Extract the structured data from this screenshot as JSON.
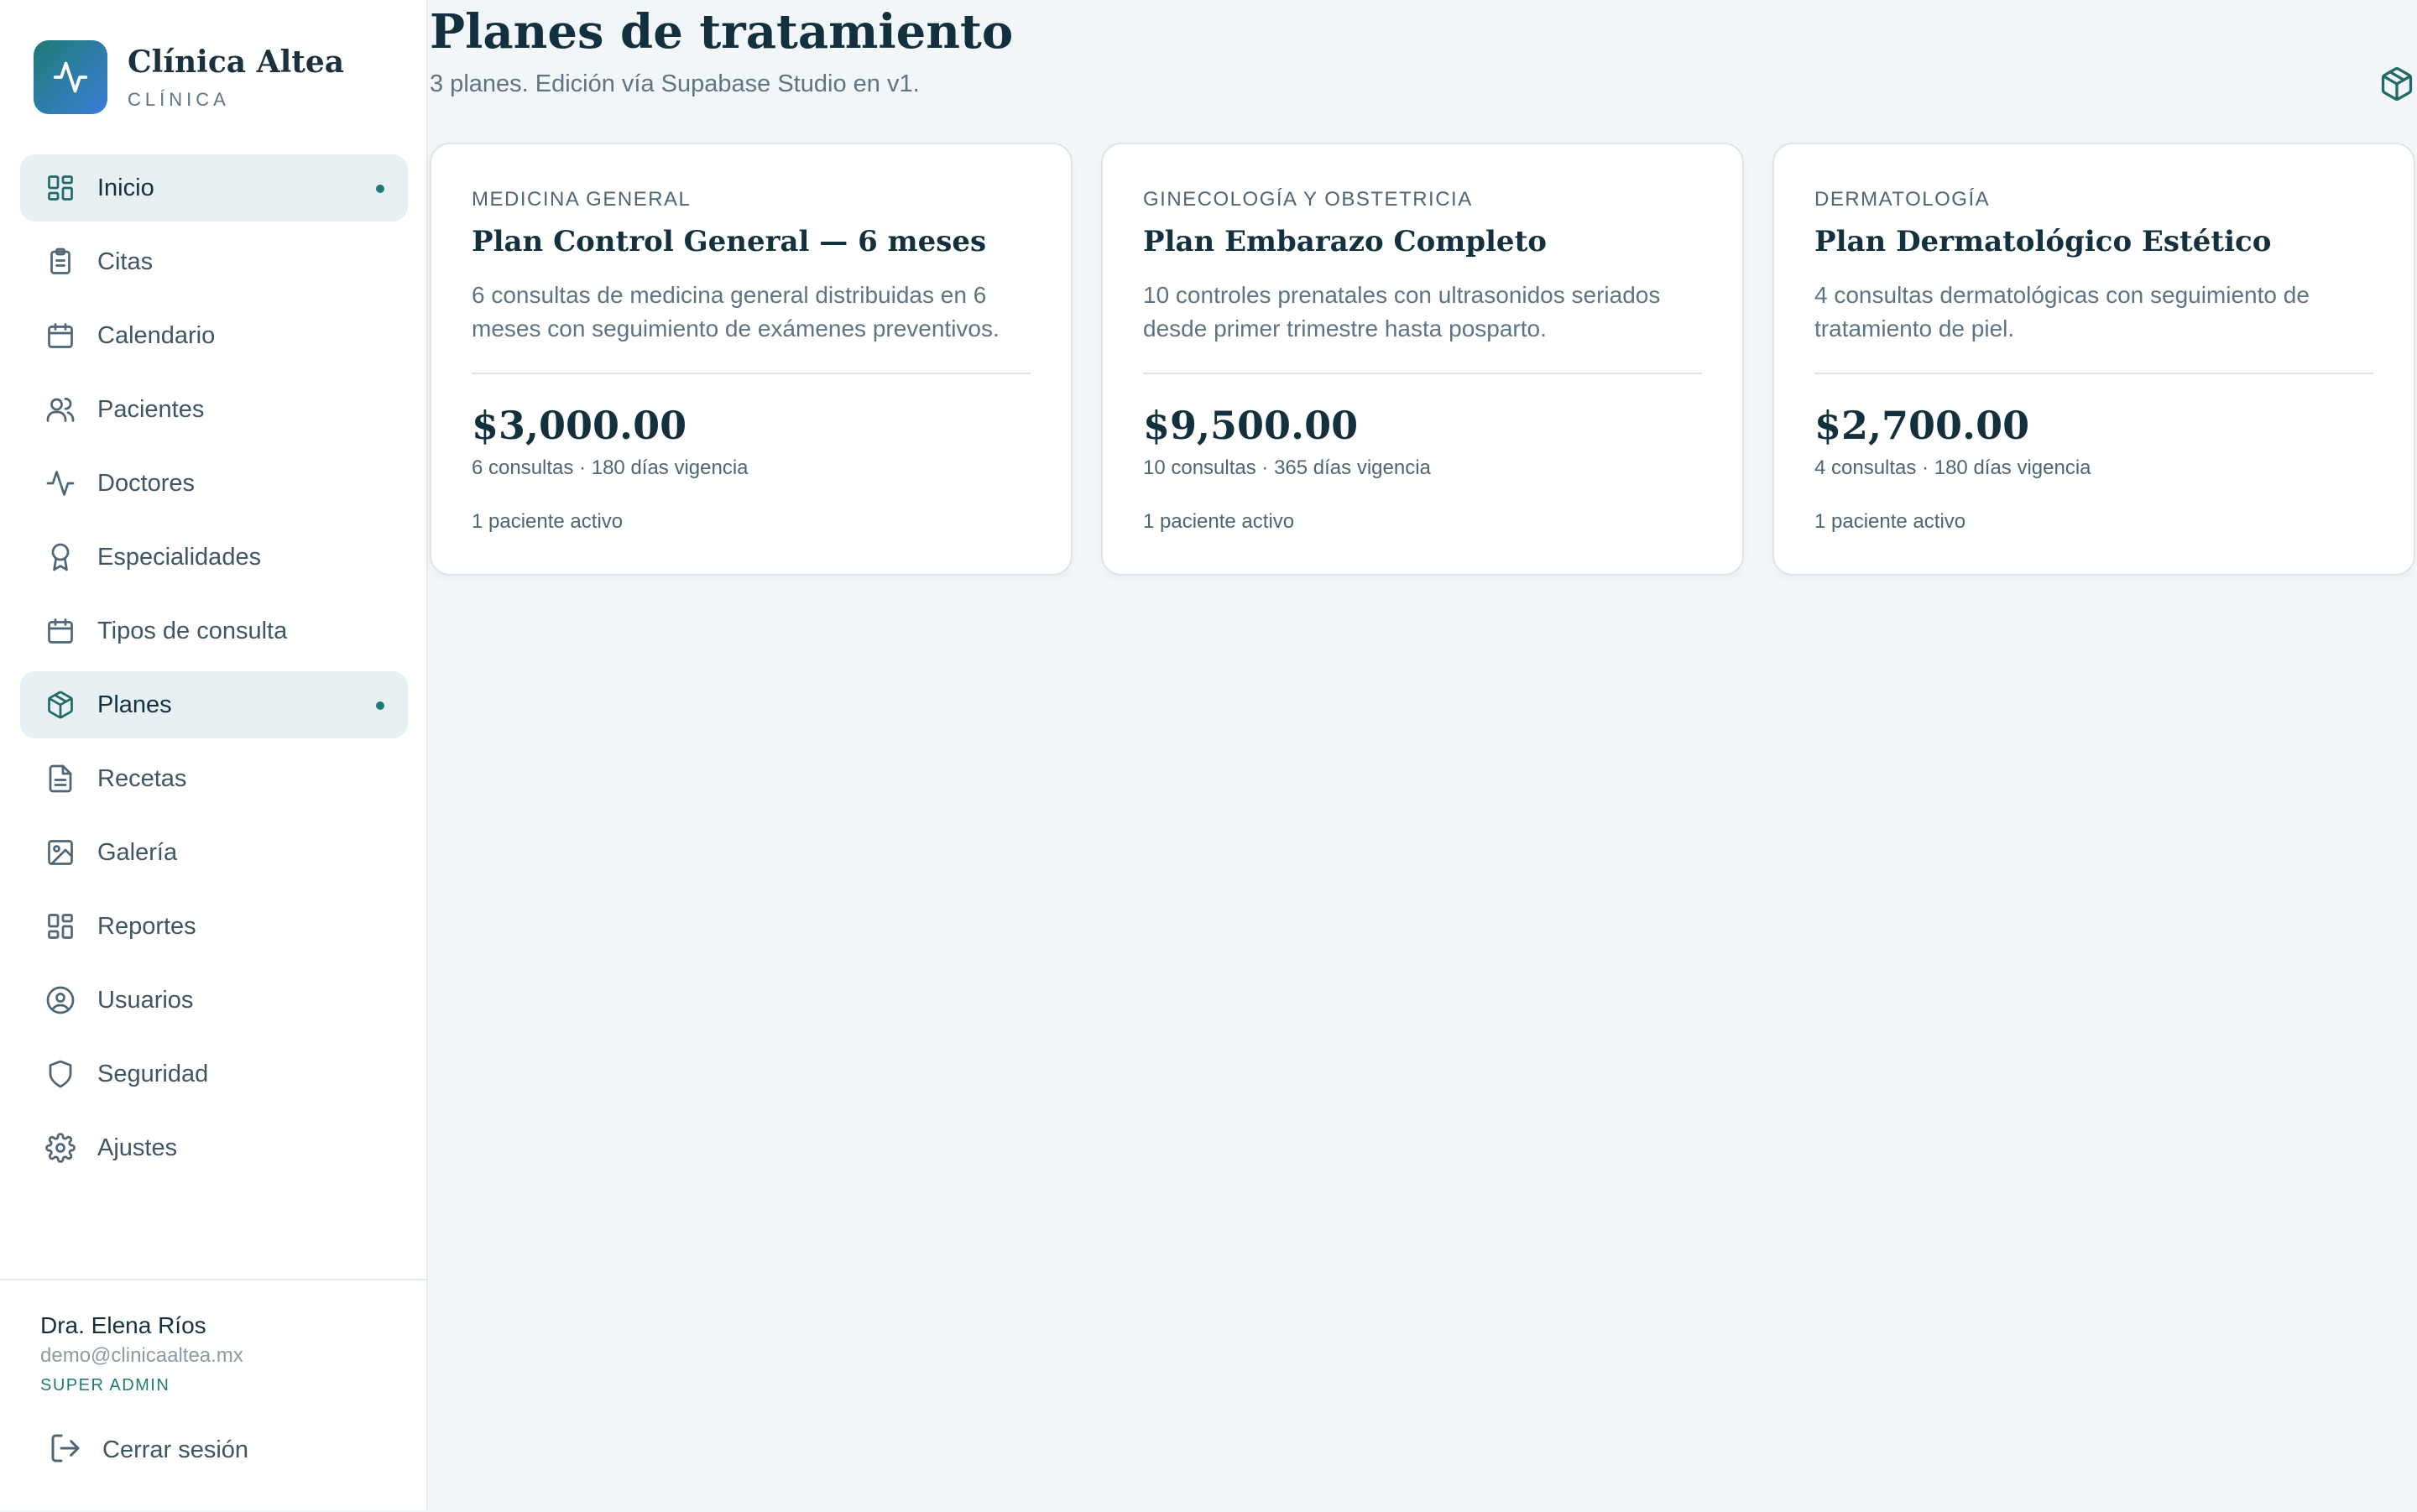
{
  "brand": {
    "name": "Clínica Altea",
    "subtitle": "CLÍNICA"
  },
  "sidebar": {
    "items": [
      {
        "label": "Inicio",
        "icon": "grid-icon",
        "active": true
      },
      {
        "label": "Citas",
        "icon": "clipboard-icon",
        "active": false
      },
      {
        "label": "Calendario",
        "icon": "calendar-icon",
        "active": false
      },
      {
        "label": "Pacientes",
        "icon": "users-icon",
        "active": false
      },
      {
        "label": "Doctores",
        "icon": "activity-icon",
        "active": false
      },
      {
        "label": "Especialidades",
        "icon": "award-icon",
        "active": false
      },
      {
        "label": "Tipos de consulta",
        "icon": "calendar-icon",
        "active": false
      },
      {
        "label": "Planes",
        "icon": "package-icon",
        "active": true
      },
      {
        "label": "Recetas",
        "icon": "file-text-icon",
        "active": false
      },
      {
        "label": "Galería",
        "icon": "image-icon",
        "active": false
      },
      {
        "label": "Reportes",
        "icon": "grid-icon",
        "active": false
      },
      {
        "label": "Usuarios",
        "icon": "user-circle-icon",
        "active": false
      },
      {
        "label": "Seguridad",
        "icon": "shield-icon",
        "active": false
      },
      {
        "label": "Ajustes",
        "icon": "gear-icon",
        "active": false
      }
    ]
  },
  "user": {
    "name": "Dra. Elena Ríos",
    "email": "demo@clinicaaltea.mx",
    "role": "SUPER ADMIN",
    "logout_label": "Cerrar sesión"
  },
  "page": {
    "title": "Planes de tratamiento",
    "subtitle": "3 planes. Edición vía Supabase Studio en v1."
  },
  "plans": [
    {
      "category": "MEDICINA GENERAL",
      "title": "Plan Control General — 6 meses",
      "description": "6 consultas de medicina general distribuidas en 6 meses con seguimiento de exámenes preventivos.",
      "price": "$3,000.00",
      "meta": "6 consultas · 180 días vigencia",
      "active_patients": "1 paciente activo"
    },
    {
      "category": "GINECOLOGÍA Y OBSTETRICIA",
      "title": "Plan Embarazo Completo",
      "description": "10 controles prenatales con ultrasonidos seriados desde primer trimestre hasta posparto.",
      "price": "$9,500.00",
      "meta": "10 consultas · 365 días vigencia",
      "active_patients": "1 paciente activo"
    },
    {
      "category": "DERMATOLOGÍA",
      "title": "Plan Dermatológico Estético",
      "description": "4 consultas dermatológicas con seguimiento de tratamiento de piel.",
      "price": "$2,700.00",
      "meta": "4 consultas · 180 días vigencia",
      "active_patients": "1 paciente activo"
    }
  ],
  "colors": {
    "accent": "#1f7a74",
    "background": "#f3f6f9",
    "active_nav": "#e7eff2",
    "logo_gradient_start": "#1f7a74",
    "logo_gradient_end": "#3a7fd8"
  }
}
